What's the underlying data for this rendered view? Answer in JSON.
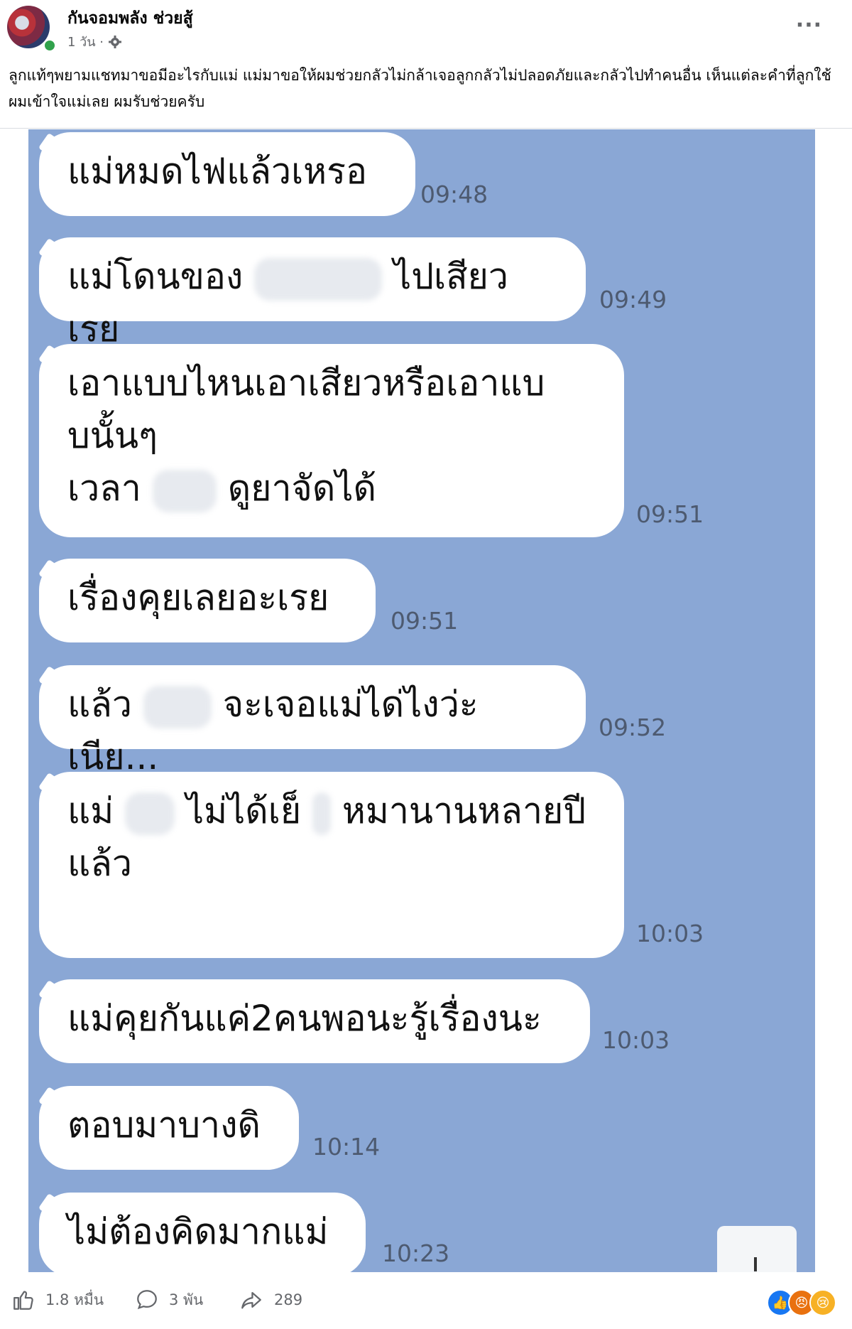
{
  "post": {
    "page_name": "กันจอมพลัง ช่วยสู้",
    "time": "1 วัน ·",
    "caption": "ลูกแท้ๆพยามแชทมาขอมีอะไรกับแม่ แม่มาขอให้ผมช่วยกลัวไม่กล้าเจอลูกกลัวไม่ปลอดภัยและกลัวไปทำคนอื่น เห็นแต่ละคำที่ลูกใช้ผมเข้าใจแม่เลย ผมรับช่วยครับ",
    "more_label": "···"
  },
  "chat": {
    "messages": [
      {
        "text": "แม่หมดไฟแล้วเหรอ",
        "time": "09:48"
      },
      {
        "text_a": "แม่โดนของ",
        "text_b": "ไปเสียวเรย",
        "time": "09:49"
      },
      {
        "text": "เอาแบบไหนเอาเสียวหรือเอาแบ\nบนั้นๆ",
        "text_a": "เวลา",
        "text_b": "ดูยาจัดได้",
        "time": "09:51"
      },
      {
        "text": "เรื่องคุยเลยอะเรย",
        "time": "09:51"
      },
      {
        "text_a": "แล้ว",
        "text_b": "จะเจอแม่ได่ไงว่ะเนีย...",
        "time": "09:52"
      },
      {
        "text_a": "แม่",
        "text_b": "ไม่ได้เย็",
        "text_c": "หมานานหลายปี",
        "text_d": "แล้ว",
        "time": "10:03"
      },
      {
        "text": "แม่คุยกันแค่2คนพอนะรู้เรื่องนะ",
        "time": "10:03"
      },
      {
        "text": "ตอบมาบางดิ",
        "time": "10:14"
      },
      {
        "text": "ไม่ต้องคิดมากแม่",
        "time": "10:23"
      }
    ]
  },
  "footer": {
    "likes": "1.8 หมื่น",
    "comments": "3 พัน",
    "shares": "289"
  },
  "colors": {
    "chat_background": "#8aa7d5",
    "bubble": "#ffffff",
    "online": "#31a24c"
  }
}
